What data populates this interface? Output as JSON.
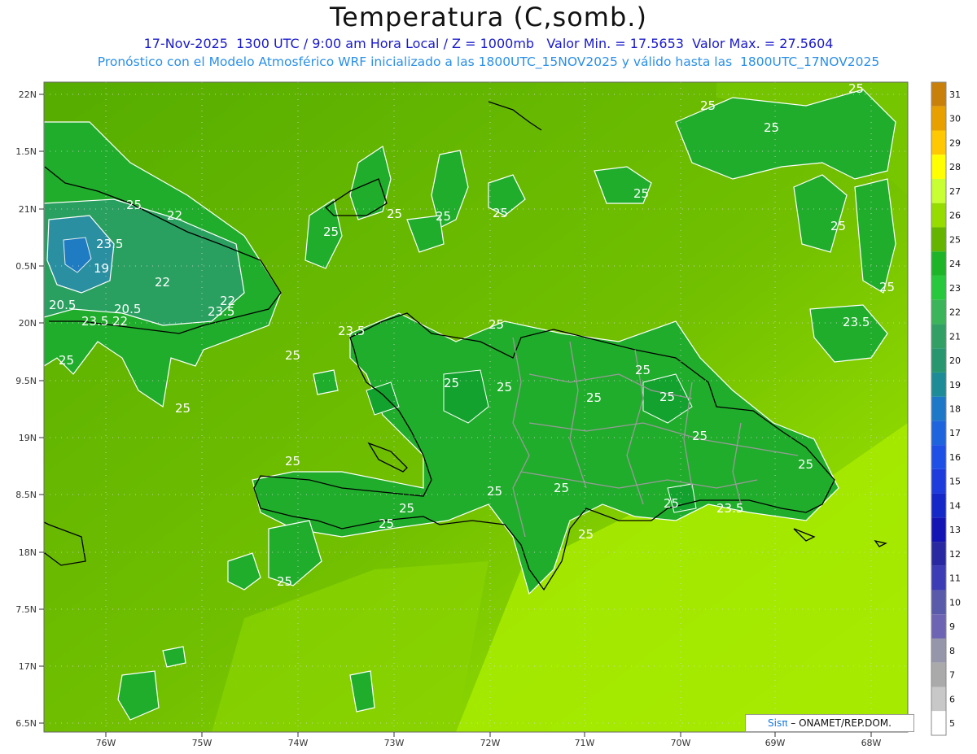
{
  "header": {
    "title": "Temperatura (C,somb.)",
    "line1": "17-Nov-2025  1300 UTC / 9:00 am Hora Local / Z = 1000mb   Valor Min. = 17.5653  Valor Max. = 27.5604",
    "line2": "Pronóstico con el Modelo Atmosférico WRF inicializado a las 1800UTC_15NOV2025 y válido hasta las  1800UTC_17NOV2025"
  },
  "axes": {
    "lat_labels": [
      "22N",
      "1.5N",
      "21N",
      "0.5N",
      "20N",
      "9.5N",
      "19N",
      "8.5N",
      "18N",
      "7.5N",
      "17N",
      "6.5N"
    ],
    "lon_labels": [
      "76W",
      "75W",
      "74W",
      "73W",
      "72W",
      "71W",
      "70W",
      "69W",
      "68W"
    ]
  },
  "colorbar": {
    "values": [
      "31",
      "30",
      "29",
      "28",
      "27",
      "26",
      "25",
      "24",
      "23",
      "22",
      "21",
      "20",
      "19",
      "18",
      "17",
      "16",
      "15",
      "14",
      "13",
      "12",
      "11",
      "10",
      "9",
      "8",
      "7",
      "6",
      "5"
    ],
    "colors": [
      "#c8800a",
      "#e8a000",
      "#ffc800",
      "#ffff00",
      "#c8ff32",
      "#96dc00",
      "#64b400",
      "#1eb428",
      "#28c83c",
      "#3cb45a",
      "#32a064",
      "#28966e",
      "#1e8c96",
      "#1e78c8",
      "#1e64dc",
      "#1e50e6",
      "#1e3cdc",
      "#1428c8",
      "#1414b4",
      "#2828a0",
      "#3c3cb4",
      "#5a5aaa",
      "#6e64b4",
      "#9696aa",
      "#aaaaaa",
      "#c8c8c8",
      "#ffffff"
    ]
  },
  "contour_labels": [
    "25",
    "22",
    "23.5",
    "20.5",
    "19",
    "22",
    "23.5",
    "22",
    "20.5",
    "23.5",
    "22",
    "25",
    "25",
    "25",
    "25",
    "25",
    "25",
    "25",
    "25",
    "25",
    "25",
    "25",
    "25",
    "23.5",
    "25",
    "25",
    "23.5",
    "25",
    "25",
    "25",
    "25",
    "25",
    "25",
    "25",
    "25",
    "25",
    "25",
    "23.5",
    "25",
    "25",
    "25",
    "25",
    "25"
  ],
  "credit": {
    "brand": "Sisπ",
    "rest": " – ONAMET/REP.DOM."
  },
  "colors": {
    "base_light": "#8cd200",
    "base_mid": "#6ab800",
    "base_green": "#22b02a",
    "contour": "#ffffff"
  }
}
